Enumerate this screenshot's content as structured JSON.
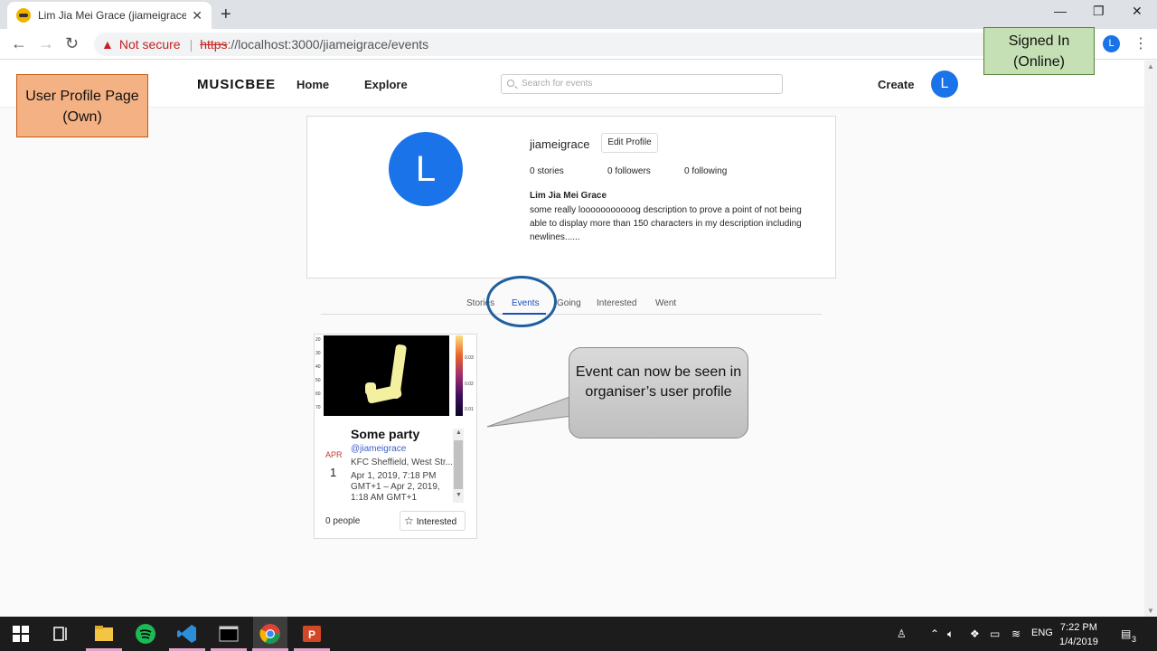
{
  "browser": {
    "tab_title": "Lim Jia Mei Grace (jiameigrace) -",
    "not_secure": "Not secure",
    "url_scheme": "https",
    "url_rest": "://localhost:3000/jiameigrace/events",
    "profile_initial": "L"
  },
  "header": {
    "logo": "MUSICBEE",
    "nav": [
      "Home",
      "Explore"
    ],
    "search_placeholder": "Search for events",
    "create": "Create",
    "avatar_initial": "L"
  },
  "annotations": {
    "page_label": "User Profile Page (Own)",
    "signed_in": "Signed In (Online)",
    "callout": "Event can now be seen in organiser’s user profile"
  },
  "profile": {
    "avatar_initial": "L",
    "username": "jiameigrace",
    "edit_button": "Edit Profile",
    "stats": [
      "0 stories",
      "0 followers",
      "0 following"
    ],
    "full_name": "Lim Jia Mei Grace",
    "description": "some really looooooooooog description to prove a point of not being able to display more than 150 characters in my description including newlines......"
  },
  "tabs": [
    {
      "label": "Stories",
      "active": false
    },
    {
      "label": "Events",
      "active": true
    },
    {
      "label": "Going",
      "active": false
    },
    {
      "label": "Interested",
      "active": false
    },
    {
      "label": "Went",
      "active": false
    }
  ],
  "event": {
    "month": "APR",
    "day": "1",
    "title": "Some party",
    "handle": "@jiameigrace",
    "venue": "KFC Sheffield, West Str...",
    "time": "Apr 1, 2019, 7:18 PM GMT+1 – Apr 2, 2019, 1:18 AM GMT+1",
    "people": "0 people",
    "interested_button": "Interested",
    "image_y_ticks": [
      "20",
      "30",
      "40",
      "50",
      "60",
      "70"
    ],
    "colorbar_ticks": [
      "0.03",
      "0.02",
      "0.01"
    ]
  },
  "taskbar": {
    "lang": "ENG",
    "time": "7:22 PM",
    "date": "1/4/2019",
    "notifications": "3"
  }
}
